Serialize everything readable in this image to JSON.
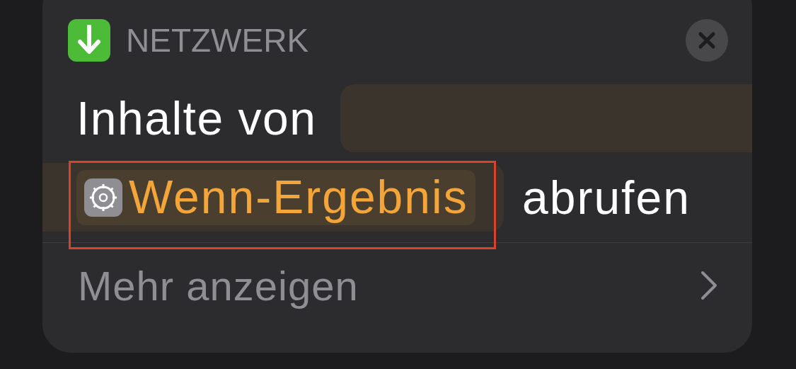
{
  "header": {
    "category": "NETZWERK"
  },
  "action": {
    "label": "Inhalte von",
    "variable": {
      "label": "Wenn-Ergebnis",
      "highlighted": true
    },
    "suffix": "abrufen"
  },
  "more": {
    "label": "Mehr anzeigen"
  }
}
